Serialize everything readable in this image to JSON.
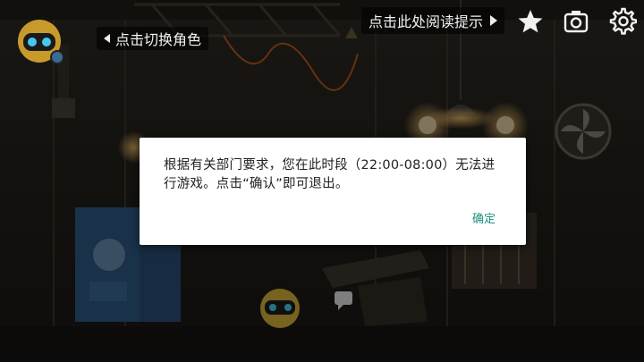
{
  "hud": {
    "switch_character_label": "点击切换角色",
    "reading_hint_label": "点击此处阅读提示"
  },
  "icons": {
    "star": "star-icon",
    "camera": "camera-icon",
    "settings": "gear-icon",
    "character": "robot-avatar-icon"
  },
  "dialog": {
    "message": "根据有关部门要求，您在此时段（22:00-08:00）无法进行游戏。点击“确认”即可退出。",
    "confirm_label": "确定",
    "confirm_color": "#1b8f82"
  }
}
